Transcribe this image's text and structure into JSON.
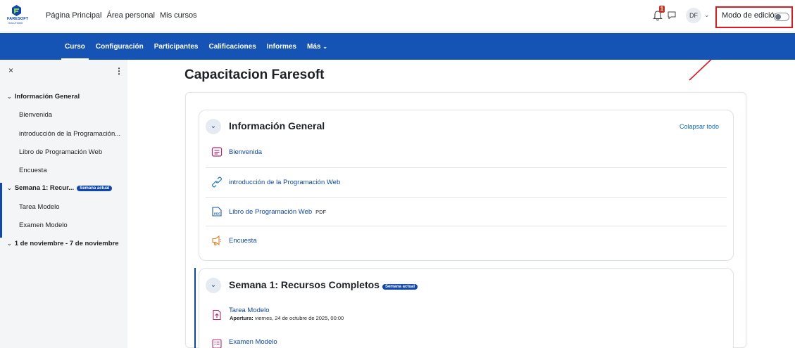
{
  "logo": {
    "brand": "FARESOFT",
    "sub": "SOLUTIONS"
  },
  "topnav": [
    "Página Principal",
    "Área personal",
    "Mis cursos"
  ],
  "user": {
    "initials": "DF",
    "notifications": "1"
  },
  "edit_mode": {
    "label": "Modo de edición",
    "enabled": false
  },
  "secnav": [
    "Curso",
    "Configuración",
    "Participantes",
    "Calificaciones",
    "Informes",
    "Más"
  ],
  "drawer": {
    "close": "×",
    "menu": "⋮",
    "sections": [
      {
        "title": "Información General",
        "items": [
          "Bienvenida",
          "introducción de la Programación...",
          "Libro de Programación Web",
          "Encuesta"
        ]
      },
      {
        "title": "Semana 1: Recur...",
        "badge": "Semana actual",
        "items": [
          "Tarea Modelo",
          "Examen Modelo"
        ]
      },
      {
        "title": "1 de noviembre - 7 de noviembre"
      }
    ]
  },
  "page_title": "Capacitacion Faresoft",
  "collapse_all": "Colapsar todo",
  "section1": {
    "title": "Información General",
    "activities": [
      {
        "name": "Bienvenida",
        "icon": "page-icon"
      },
      {
        "name": "introducción de la Programación Web",
        "icon": "url-icon"
      },
      {
        "name": "Libro de Programación Web",
        "tag": "PDF",
        "icon": "pdf-icon"
      },
      {
        "name": "Encuesta",
        "icon": "feedback-icon"
      }
    ]
  },
  "section2": {
    "title": "Semana 1: Recursos Completos",
    "badge": "Semana actual",
    "activities": [
      {
        "name": "Tarea Modelo",
        "icon": "assignment-icon",
        "detail_label": "Apertura:",
        "detail_value": " viernes, 24 de octubre de 2025, 00:00"
      },
      {
        "name": "Examen Modelo",
        "icon": "quiz-icon"
      }
    ]
  },
  "colors": {
    "brand_blue": "#1553b5",
    "link_blue": "#0f47ad",
    "highlight_red": "#e0191f",
    "activity_pink": "#c1246c",
    "activity_orange": "#e67e22"
  }
}
